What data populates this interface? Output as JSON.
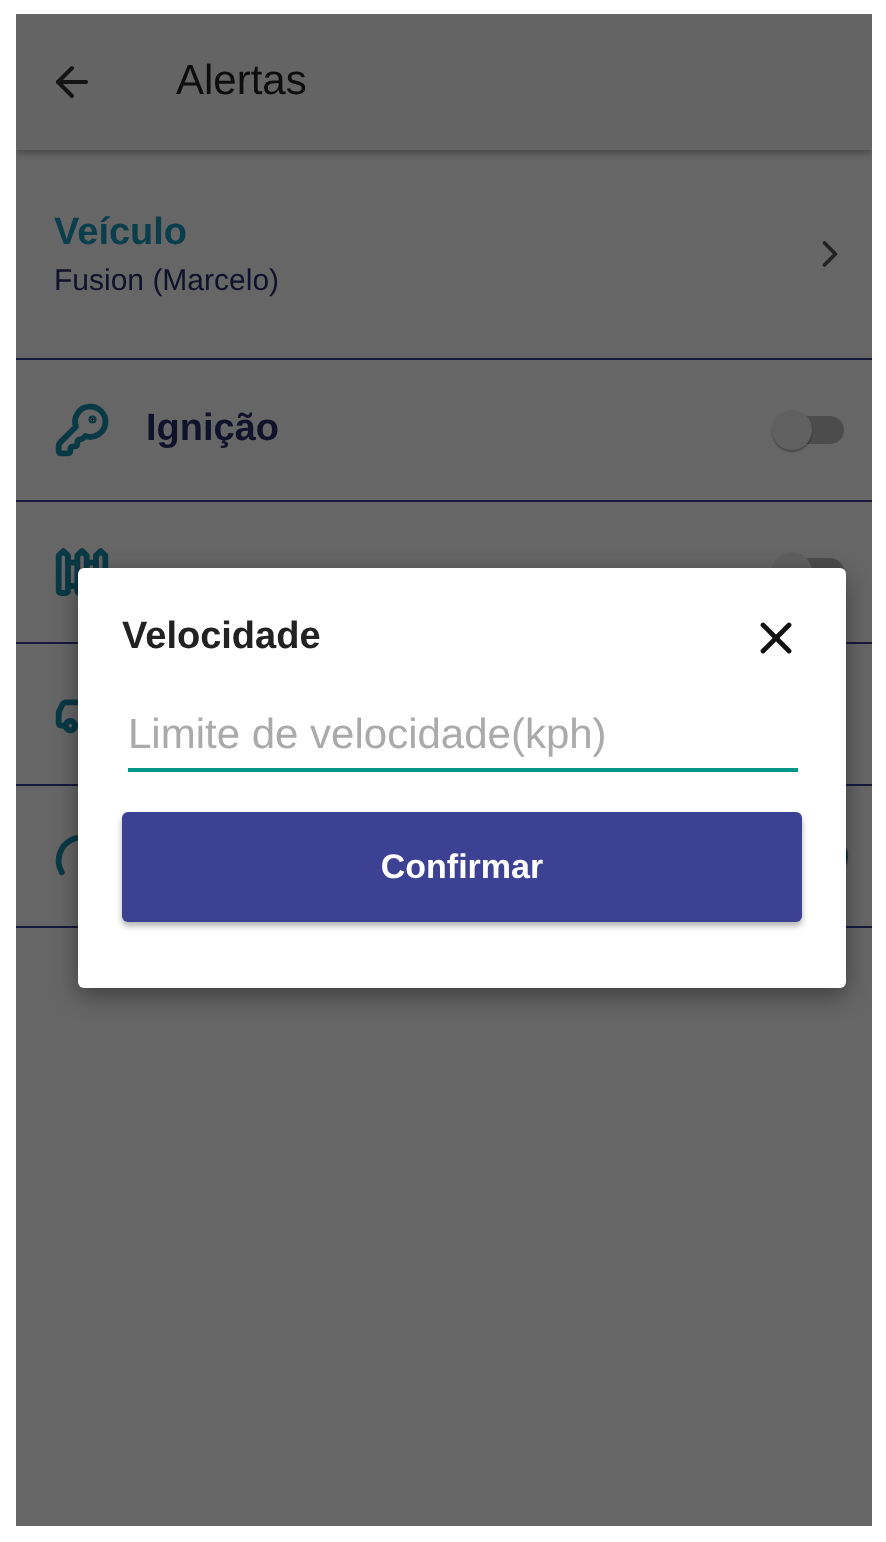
{
  "app_bar": {
    "title": "Alertas"
  },
  "vehicle": {
    "label": "Veículo",
    "value": "Fusion (Marcelo)"
  },
  "alerts": [
    {
      "kind": "key",
      "label": "Ignição",
      "on": false
    },
    {
      "kind": "fence",
      "on": false
    },
    {
      "kind": "car"
    },
    {
      "kind": "gauge",
      "on": true
    }
  ],
  "dialog": {
    "title": "Velocidade",
    "field": {
      "placeholder": "Limite de velocidade(kph)"
    },
    "button": "Confirmar"
  }
}
